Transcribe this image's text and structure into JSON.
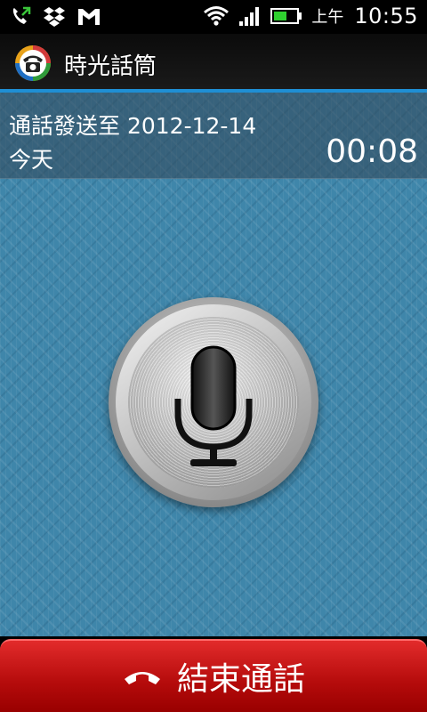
{
  "status_bar": {
    "icons": [
      "missed-call-icon",
      "dropbox-icon",
      "gmail-icon",
      "wifi-icon",
      "signal-icon",
      "battery-icon"
    ],
    "ampm": "上午",
    "time": "10:55"
  },
  "app": {
    "title": "時光話筒",
    "icon": "vintage-phone-icon",
    "accent_color": "#1f8fd4"
  },
  "call_info": {
    "sent_to_label": "通話發送至 2012-12-14",
    "date_label": "今天",
    "timer": "00:08"
  },
  "mic": {
    "icon": "microphone-icon"
  },
  "end_call": {
    "label": "結束通話",
    "icon": "hang-up-icon",
    "color": "#c81414"
  }
}
